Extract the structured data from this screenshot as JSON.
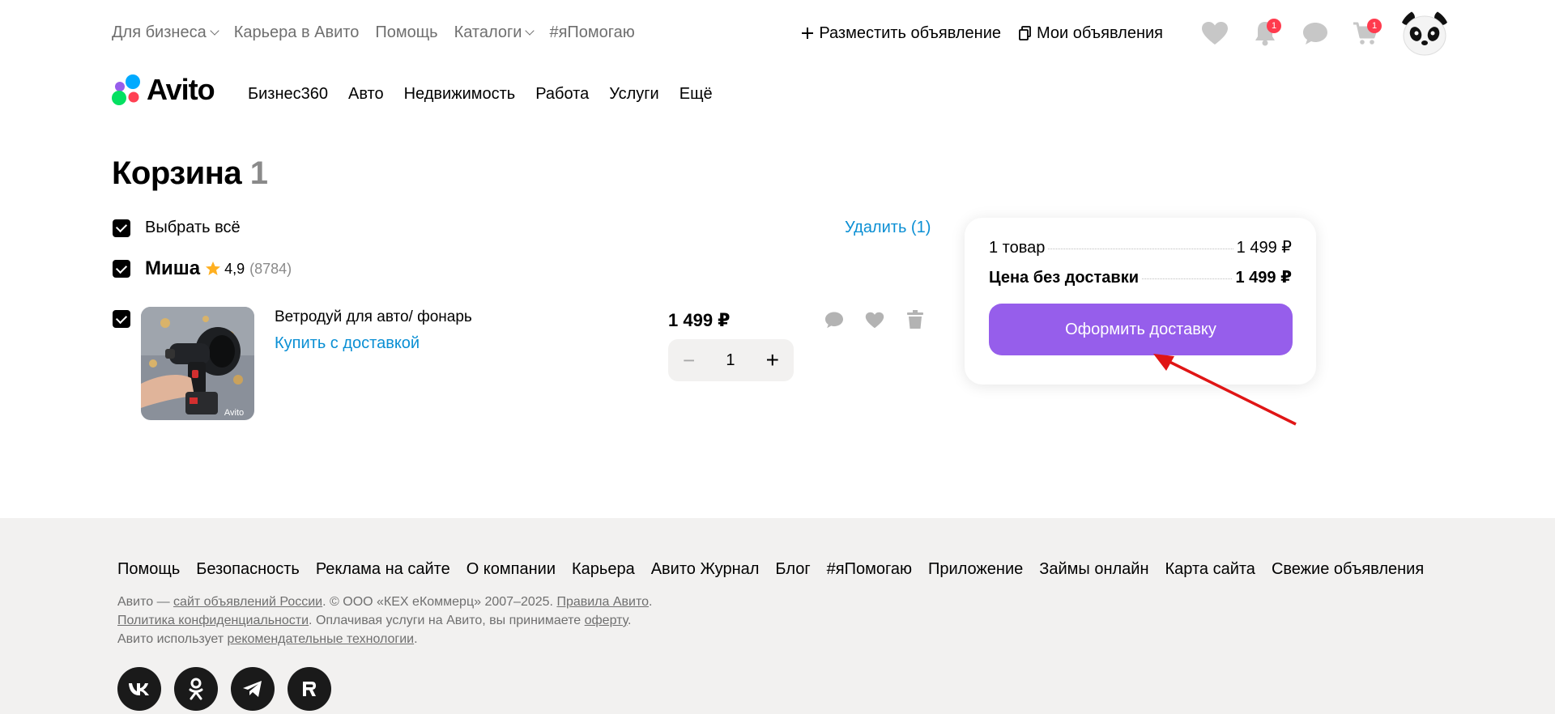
{
  "topnav": {
    "business": "Для бизнеса",
    "career": "Карьера в Авито",
    "help": "Помощь",
    "catalogs": "Каталоги",
    "help_tag": "#яПомогаю"
  },
  "topright": {
    "post_ad": "Разместить объявление",
    "my_ads": "Мои объявления",
    "notifications_badge": "1",
    "cart_badge": "1"
  },
  "logo": {
    "text": "Avito"
  },
  "catnav": [
    "Бизнес360",
    "Авто",
    "Недвижимость",
    "Работа",
    "Услуги",
    "Ещё"
  ],
  "cart": {
    "title": "Корзина",
    "count": "1",
    "select_all": "Выбрать всё",
    "delete": "Удалить (1)",
    "seller": {
      "name": "Миша",
      "rating": "4,9",
      "reviews": "(8784)"
    },
    "item": {
      "title": "Ветродуй для авто/ фонарь",
      "buy_link": "Купить с доставкой",
      "price": "1 499 ₽",
      "quantity": "1",
      "image_watermark": "Avito"
    }
  },
  "summary": {
    "items_label": "1 товар",
    "items_price": "1 499 ₽",
    "no_delivery_label": "Цена без доставки",
    "no_delivery_price": "1 499 ₽",
    "checkout": "Оформить доставку",
    "accent": "#965eeb"
  },
  "footer": {
    "links": [
      "Помощь",
      "Безопасность",
      "Реклама на сайте",
      "О компании",
      "Карьера",
      "Авито Журнал",
      "Блог",
      "#яПомогаю",
      "Приложение",
      "Займы онлайн",
      "Карта сайта",
      "Свежие объявления"
    ],
    "legal": {
      "l1_a": "Авито — ",
      "l1_link": "сайт объявлений России",
      "l1_b": ". © ООО «КЕХ еКоммерц» 2007–2025. ",
      "l1_link2": "Правила Авито",
      "l1_c": ".",
      "l2_link": "Политика конфиденциальности",
      "l2_a": ". Оплачивая услуги на Авито, вы принимаете ",
      "l2_link2": "оферту",
      "l2_b": ".",
      "l3_a": "Авито использует ",
      "l3_link": "рекомендательные технологии",
      "l3_b": "."
    },
    "social": [
      "VK",
      "OK",
      "Telegram",
      "RuTube"
    ]
  }
}
